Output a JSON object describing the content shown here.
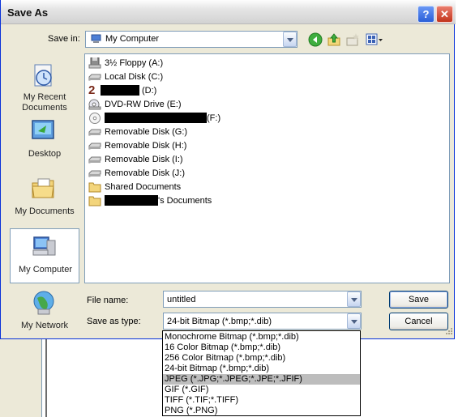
{
  "window": {
    "title": "Save As",
    "help": "?",
    "close": "✕"
  },
  "toolbar": {
    "save_in_label": "Save in:",
    "save_in_value": "My Computer"
  },
  "places": [
    {
      "label": "My Recent\nDocuments",
      "icon": "recent-documents-icon"
    },
    {
      "label": "Desktop",
      "icon": "desktop-icon"
    },
    {
      "label": "My Documents",
      "icon": "my-documents-icon"
    },
    {
      "label": "My Computer",
      "icon": "my-computer-icon",
      "selected": true
    },
    {
      "label": "My Network",
      "icon": "network-icon"
    }
  ],
  "files": [
    {
      "label": "3½ Floppy (A:)",
      "icon": "floppy-icon"
    },
    {
      "label": "Local Disk (C:)",
      "icon": "drive-icon"
    },
    {
      "label": "(D:)",
      "icon": "drive-2-icon"
    },
    {
      "label": "DVD-RW Drive (E:)",
      "icon": "dvd-drive-icon"
    },
    {
      "label": "(F:)",
      "icon": "cd-icon"
    },
    {
      "label": "Removable Disk (G:)",
      "icon": "drive-icon"
    },
    {
      "label": "Removable Disk (H:)",
      "icon": "drive-icon"
    },
    {
      "label": "Removable Disk (I:)",
      "icon": "drive-icon"
    },
    {
      "label": "Removable Disk (J:)",
      "icon": "drive-icon"
    },
    {
      "label": "Shared Documents",
      "icon": "folder-icon"
    },
    {
      "label": "'s Documents",
      "icon": "folder-icon"
    }
  ],
  "form": {
    "file_name_label": "File name:",
    "file_name_value": "untitled",
    "save_as_type_label": "Save as type:",
    "save_as_type_value": "24-bit Bitmap (*.bmp;*.dib)"
  },
  "buttons": {
    "save": "Save",
    "cancel": "Cancel"
  },
  "type_options": [
    {
      "label": "Monochrome Bitmap (*.bmp;*.dib)"
    },
    {
      "label": "16 Color Bitmap (*.bmp;*.dib)"
    },
    {
      "label": "256 Color Bitmap (*.bmp;*.dib)"
    },
    {
      "label": "24-bit Bitmap (*.bmp;*.dib)"
    },
    {
      "label": "JPEG (*.JPG;*.JPEG;*.JPE;*.JFIF)",
      "highlighted": true
    },
    {
      "label": "GIF (*.GIF)"
    },
    {
      "label": "TIFF (*.TIF;*.TIFF)"
    },
    {
      "label": "PNG (*.PNG)"
    }
  ],
  "colors": {
    "highlight": "#bdbdbd",
    "dialog_bg": "#ece9d8",
    "border": "#7f9db9"
  }
}
